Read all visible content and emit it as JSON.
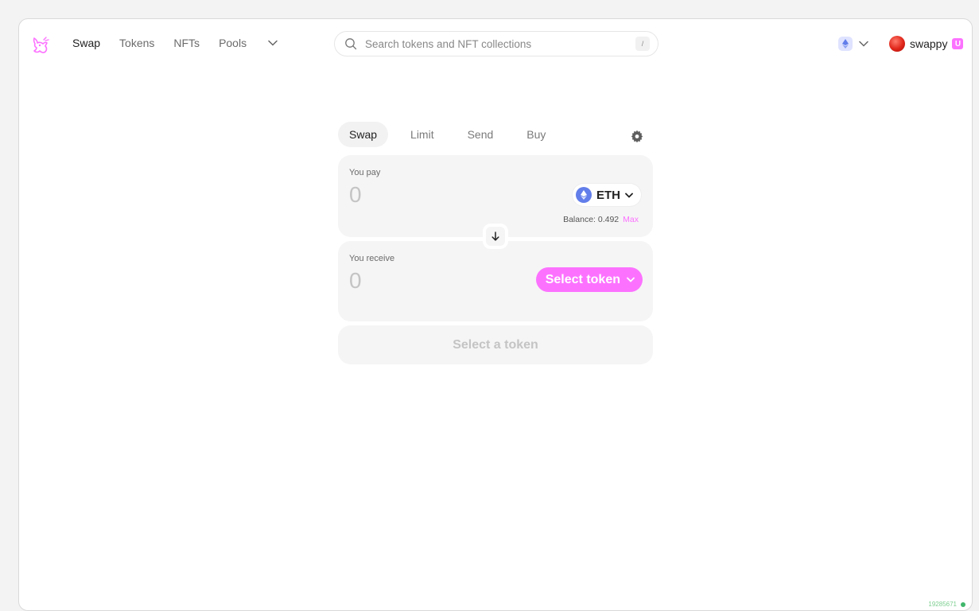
{
  "nav": {
    "links": [
      {
        "label": "Swap",
        "active": true
      },
      {
        "label": "Tokens",
        "active": false
      },
      {
        "label": "NFTs",
        "active": false
      },
      {
        "label": "Pools",
        "active": false
      }
    ],
    "more_icon": "chevron-down-icon",
    "logo_icon": "uniswap-unicorn-logo",
    "brand_color": "#fc72ff"
  },
  "search": {
    "placeholder": "Search tokens and NFT collections",
    "shortcut": "/"
  },
  "chain": {
    "icon": "ethereum-icon",
    "dropdown_icon": "chevron-down-icon"
  },
  "account": {
    "name": "swappy",
    "badge": "U"
  },
  "swap": {
    "tabs": [
      {
        "label": "Swap",
        "active": true
      },
      {
        "label": "Limit",
        "active": false
      },
      {
        "label": "Send",
        "active": false
      },
      {
        "label": "Buy",
        "active": false
      }
    ],
    "settings_icon": "gear-icon",
    "pay": {
      "label": "You pay",
      "amount": "0",
      "token": "ETH",
      "balance": "Balance: 0.492",
      "max": "Max"
    },
    "switch_icon": "arrow-down-icon",
    "receive": {
      "label": "You receive",
      "amount": "0",
      "select_label": "Select token"
    },
    "cta_label": "Select a token"
  },
  "footer": {
    "block_number": "19285671",
    "status_color": "#40b66b"
  }
}
